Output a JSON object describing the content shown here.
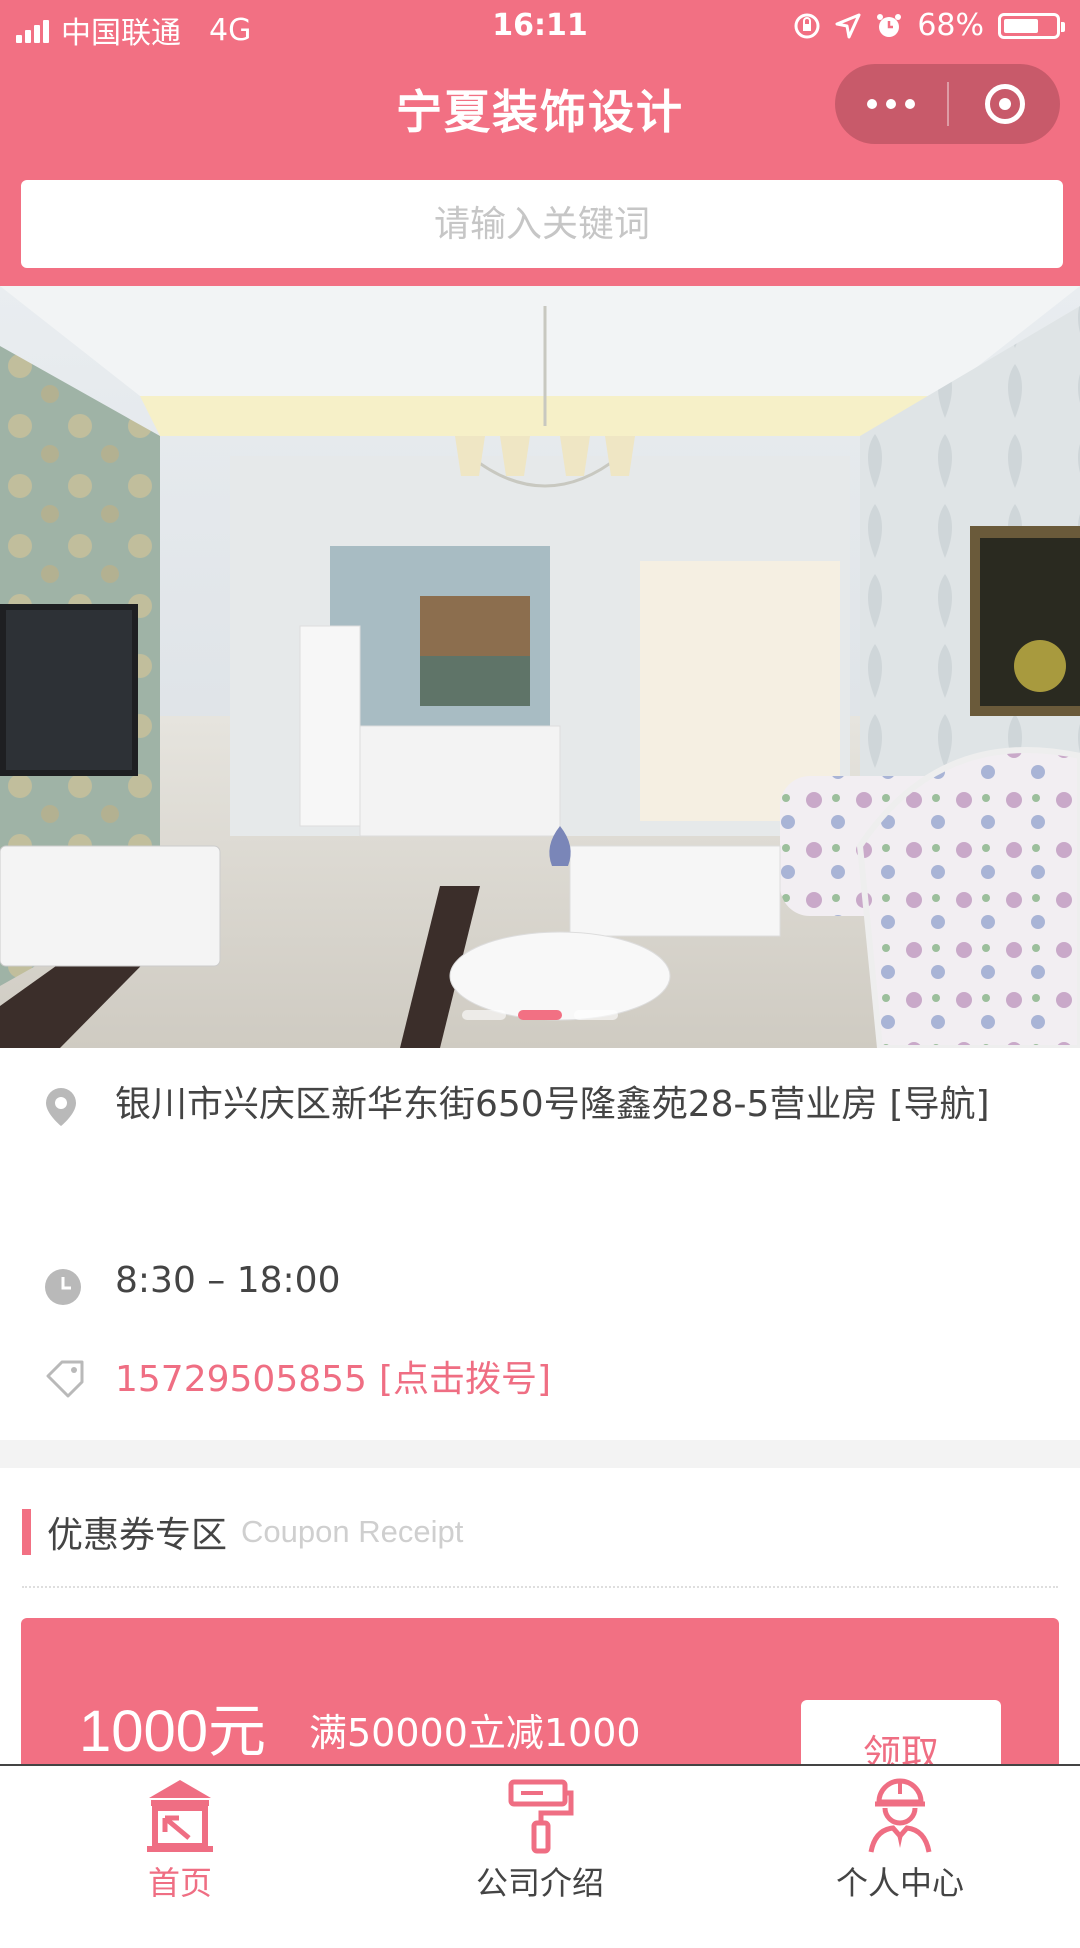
{
  "status_bar": {
    "carrier": "中国联通",
    "network": "4G",
    "time": "16:11",
    "battery": "68%",
    "battery_level": 0.68
  },
  "nav": {
    "title": "宁夏装饰设计"
  },
  "search": {
    "placeholder": "请输入关键词"
  },
  "banner": {
    "image": "living-room-interior-photo",
    "slide_count": 3,
    "active_slide": 1
  },
  "store": {
    "address": "银川市兴庆区新华东街650号隆鑫苑28-5营业房",
    "navigate_label": "[导航]",
    "hours": "8:30 – 18:00",
    "phone": "15729505855",
    "call_label": "[点击拨号]"
  },
  "coupon_section": {
    "title": "优惠券专区",
    "subtitle": "Coupon Receipt",
    "coupons": [
      {
        "amount": "1000元",
        "rule": "满50000立减1000",
        "button": "领取"
      }
    ]
  },
  "tabbar": {
    "items": [
      {
        "label": "首页",
        "icon": "home-icon",
        "active": true
      },
      {
        "label": "公司介绍",
        "icon": "paint-roller-icon",
        "active": false
      },
      {
        "label": "个人中心",
        "icon": "worker-helmet-icon",
        "active": false
      }
    ]
  },
  "colors": {
    "brand": "#f27083",
    "accent_text": "#ef6e83",
    "capsule": "#c85a6a"
  }
}
